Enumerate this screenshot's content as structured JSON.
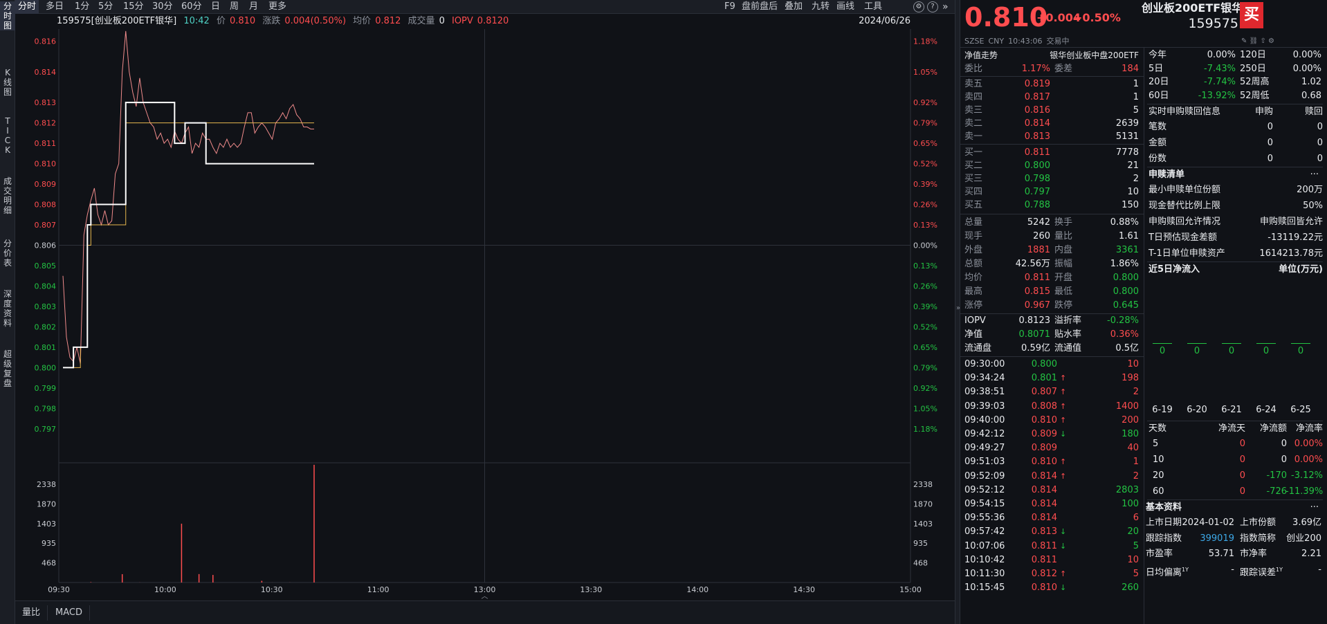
{
  "toolbar": {
    "tabs": [
      "分时",
      "多日",
      "1分",
      "5分",
      "15分",
      "30分",
      "60分",
      "日",
      "周",
      "月",
      "更多"
    ],
    "right": [
      "F9",
      "盘前盘后",
      "叠加",
      "九转",
      "画线",
      "工具"
    ]
  },
  "leftbar": [
    "分时图",
    "K线图",
    "TICK",
    "成交明细",
    "分价表",
    "深度资料",
    "超级复盘"
  ],
  "infobar": {
    "code": "159575[创业板200ETF银华]",
    "time": "10:42",
    "price_label": "价",
    "price": "0.810",
    "chg_label": "涨跌",
    "chg": "0.004(0.50%)",
    "avg_label": "均价",
    "avg": "0.812",
    "vol_label": "成交量",
    "vol": "0",
    "iopv_label": "IOPV",
    "iopv": "0.8120",
    "date": "2024/06/26"
  },
  "chart_data": {
    "type": "line",
    "y_left": [
      "0.816",
      "0.814",
      "0.813",
      "0.812",
      "0.811",
      "0.810",
      "0.809",
      "0.808",
      "0.807",
      "0.806",
      "0.805",
      "0.804",
      "0.803",
      "0.802",
      "0.801",
      "0.800",
      "0.799",
      "0.798",
      "0.797"
    ],
    "y_right": [
      "1.18%",
      "1.05%",
      "0.92%",
      "0.79%",
      "0.65%",
      "0.52%",
      "0.39%",
      "0.26%",
      "0.13%",
      "0.00%",
      "0.13%",
      "0.26%",
      "0.39%",
      "0.52%",
      "0.65%",
      "0.79%",
      "0.92%",
      "1.05%",
      "1.18%"
    ],
    "vol_ticks": [
      "2338",
      "1870",
      "1403",
      "935",
      "468"
    ],
    "x_labels": [
      "09:30",
      "10:00",
      "10:30",
      "11:00",
      "13:00",
      "13:30",
      "14:00",
      "14:30",
      "15:00"
    ],
    "price_series": [
      0.8,
      0.8,
      0.8,
      0.801,
      0.801,
      0.801,
      0.801,
      0.807,
      0.808,
      0.808,
      0.808,
      0.808,
      0.808,
      0.808,
      0.808,
      0.808,
      0.808,
      0.808,
      0.813,
      0.813,
      0.813,
      0.813,
      0.813,
      0.813,
      0.813,
      0.813,
      0.813,
      0.813,
      0.813,
      0.813,
      0.813,
      0.813,
      0.811,
      0.811,
      0.811,
      0.812,
      0.812,
      0.812,
      0.812,
      0.812,
      0.812,
      0.81,
      0.81,
      0.81,
      0.81,
      0.81,
      0.81,
      0.81,
      0.81,
      0.81,
      0.81,
      0.81,
      0.81,
      0.81,
      0.81,
      0.81,
      0.81,
      0.81,
      0.81,
      0.81,
      0.81,
      0.81,
      0.81,
      0.81,
      0.81,
      0.81,
      0.81,
      0.81,
      0.81,
      0.81,
      0.81,
      0.81,
      0.81
    ],
    "avg_series": [
      0.8,
      0.8,
      0.8,
      0.8,
      0.8,
      0.801,
      0.801,
      0.806,
      0.807,
      0.807,
      0.807,
      0.807,
      0.807,
      0.807,
      0.807,
      0.807,
      0.807,
      0.807,
      0.812,
      0.812,
      0.812,
      0.812,
      0.812,
      0.812,
      0.812,
      0.812,
      0.812,
      0.812,
      0.812,
      0.812,
      0.812,
      0.812,
      0.812,
      0.812,
      0.812,
      0.812,
      0.812,
      0.812,
      0.812,
      0.812,
      0.812,
      0.812,
      0.812,
      0.812,
      0.812,
      0.812,
      0.812,
      0.812,
      0.812,
      0.812,
      0.812,
      0.812,
      0.812,
      0.812,
      0.812,
      0.812,
      0.812,
      0.812,
      0.812,
      0.812,
      0.812,
      0.812,
      0.812,
      0.812,
      0.812,
      0.812,
      0.812,
      0.812,
      0.812,
      0.812,
      0.812,
      0.812,
      0.812
    ],
    "iopv_series": [
      0.8045,
      0.8015,
      0.8005,
      0.8003,
      0.801,
      0.8002,
      0.8065,
      0.8075,
      0.8082,
      0.8088,
      0.8075,
      0.807,
      0.8077,
      0.807,
      0.8072,
      0.8095,
      0.81,
      0.8145,
      0.8165,
      0.8145,
      0.8135,
      0.8128,
      0.8142,
      0.813,
      0.8125,
      0.812,
      0.8118,
      0.8112,
      0.8115,
      0.811,
      0.8112,
      0.8108,
      0.8116,
      0.8112,
      0.811,
      0.8115,
      0.8118,
      0.8105,
      0.811,
      0.8108,
      0.8115,
      0.8112,
      0.8112,
      0.8108,
      0.8105,
      0.811,
      0.8108,
      0.8112,
      0.8108,
      0.811,
      0.8108,
      0.811,
      0.8118,
      0.8125,
      0.8125,
      0.8115,
      0.8118,
      0.812,
      0.8118,
      0.8115,
      0.8112,
      0.812,
      0.8122,
      0.8125,
      0.8122,
      0.8127,
      0.8129,
      0.8124,
      0.8122,
      0.8118,
      0.8118,
      0.8117,
      0.8117
    ],
    "volume_series": [
      0,
      0,
      0,
      0,
      0,
      0,
      0,
      0,
      10,
      0,
      0,
      0,
      0,
      0,
      0,
      0,
      0,
      198,
      0,
      0,
      0,
      0,
      2,
      0,
      0,
      0,
      0,
      0,
      0,
      0,
      0,
      0,
      0,
      0,
      1400,
      0,
      0,
      0,
      0,
      200,
      0,
      0,
      0,
      180,
      0,
      0,
      0,
      0,
      0,
      0,
      0,
      0,
      0,
      0,
      0,
      0,
      0,
      40,
      0,
      0,
      1,
      0,
      0,
      0,
      0,
      2,
      0,
      0,
      0,
      0,
      0,
      0,
      2803
    ]
  },
  "bottom_tabs": [
    "量比",
    "MACD"
  ],
  "quote": {
    "price": "0.810",
    "chg": "+0.004",
    "pct": "+0.50%",
    "name": "创业板200ETF银华",
    "code": "159575",
    "buy_btn": "买",
    "meta": [
      "SZSE",
      "CNY",
      "10:43:06",
      "交易中"
    ],
    "nav_label": "净值走势",
    "nav_name": "银华创业板中盘200ETF"
  },
  "returns": [
    {
      "l": "今年",
      "v": "0.00%",
      "l2": "120日",
      "v2": "0.00%",
      "c": "white",
      "c2": "white"
    },
    {
      "l": "5日",
      "v": "-7.43%",
      "l2": "250日",
      "v2": "0.00%",
      "c": "green",
      "c2": "white"
    },
    {
      "l": "20日",
      "v": "-7.74%",
      "l2": "52周高",
      "v2": "1.02",
      "c": "green",
      "c2": "white"
    },
    {
      "l": "60日",
      "v": "-13.92%",
      "l2": "52周低",
      "v2": "0.68",
      "c": "green",
      "c2": "white"
    }
  ],
  "order_book": {
    "webi_label": "委比",
    "webi": "1.17%",
    "weicha_label": "委差",
    "weicha": "184",
    "asks": [
      {
        "l": "卖五",
        "p": "0.819",
        "v": "1"
      },
      {
        "l": "卖四",
        "p": "0.817",
        "v": "1"
      },
      {
        "l": "卖三",
        "p": "0.816",
        "v": "5"
      },
      {
        "l": "卖二",
        "p": "0.814",
        "v": "2639"
      },
      {
        "l": "卖一",
        "p": "0.813",
        "v": "5131"
      }
    ],
    "bids": [
      {
        "l": "买一",
        "p": "0.811",
        "v": "7778"
      },
      {
        "l": "买二",
        "p": "0.800",
        "v": "21"
      },
      {
        "l": "买三",
        "p": "0.798",
        "v": "2"
      },
      {
        "l": "买四",
        "p": "0.797",
        "v": "10"
      },
      {
        "l": "买五",
        "p": "0.788",
        "v": "150"
      }
    ]
  },
  "stats": [
    {
      "l": "总量",
      "v": "5242",
      "vc": "white",
      "l2": "换手",
      "v2": "0.88%",
      "vc2": "white"
    },
    {
      "l": "现手",
      "v": "260",
      "vc": "white",
      "l2": "量比",
      "v2": "1.61",
      "vc2": "white"
    },
    {
      "l": "外盘",
      "v": "1881",
      "vc": "red",
      "l2": "内盘",
      "v2": "3361",
      "vc2": "green"
    },
    {
      "l": "总额",
      "v": "42.56万",
      "vc": "white",
      "l2": "振幅",
      "v2": "1.86%",
      "vc2": "white"
    },
    {
      "l": "均价",
      "v": "0.811",
      "vc": "red",
      "l2": "开盘",
      "v2": "0.800",
      "vc2": "green"
    },
    {
      "l": "最高",
      "v": "0.815",
      "vc": "red",
      "l2": "最低",
      "v2": "0.800",
      "vc2": "green"
    },
    {
      "l": "涨停",
      "v": "0.967",
      "vc": "red",
      "l2": "跌停",
      "v2": "0.645",
      "vc2": "green"
    }
  ],
  "stats2": [
    {
      "l": "IOPV",
      "v": "0.8123",
      "vc": "white",
      "l2": "溢折率",
      "v2": "-0.28%",
      "vc2": "green"
    },
    {
      "l": "净值",
      "v": "0.8071",
      "vc": "green",
      "l2": "贴水率",
      "v2": "0.36%",
      "vc2": "red"
    },
    {
      "l": "流通盘",
      "v": "0.59亿",
      "vc": "white",
      "l2": "流通值",
      "v2": "0.5亿",
      "vc2": "white"
    }
  ],
  "ticks": [
    {
      "t": "09:30:00",
      "p": "0.800",
      "pc": "green",
      "a": "",
      "v": "10",
      "vc": "red"
    },
    {
      "t": "09:34:24",
      "p": "0.801",
      "pc": "green",
      "a": "up",
      "v": "198",
      "vc": "red"
    },
    {
      "t": "09:38:51",
      "p": "0.807",
      "pc": "red",
      "a": "up",
      "v": "2",
      "vc": "red"
    },
    {
      "t": "09:39:03",
      "p": "0.808",
      "pc": "red",
      "a": "up",
      "v": "1400",
      "vc": "red"
    },
    {
      "t": "09:40:00",
      "p": "0.810",
      "pc": "red",
      "a": "up",
      "v": "200",
      "vc": "red"
    },
    {
      "t": "09:42:12",
      "p": "0.809",
      "pc": "red",
      "a": "down",
      "v": "180",
      "vc": "green"
    },
    {
      "t": "09:49:27",
      "p": "0.809",
      "pc": "red",
      "a": "",
      "v": "40",
      "vc": "red"
    },
    {
      "t": "09:51:03",
      "p": "0.810",
      "pc": "red",
      "a": "up",
      "v": "1",
      "vc": "red"
    },
    {
      "t": "09:52:09",
      "p": "0.814",
      "pc": "red",
      "a": "up",
      "v": "2",
      "vc": "red"
    },
    {
      "t": "09:52:12",
      "p": "0.814",
      "pc": "red",
      "a": "",
      "v": "2803",
      "vc": "green"
    },
    {
      "t": "09:54:15",
      "p": "0.814",
      "pc": "red",
      "a": "",
      "v": "100",
      "vc": "green"
    },
    {
      "t": "09:55:36",
      "p": "0.814",
      "pc": "red",
      "a": "",
      "v": "6",
      "vc": "red"
    },
    {
      "t": "09:57:42",
      "p": "0.813",
      "pc": "red",
      "a": "down",
      "v": "20",
      "vc": "green"
    },
    {
      "t": "10:07:06",
      "p": "0.811",
      "pc": "red",
      "a": "down",
      "v": "5",
      "vc": "green"
    },
    {
      "t": "10:10:42",
      "p": "0.811",
      "pc": "red",
      "a": "",
      "v": "10",
      "vc": "red"
    },
    {
      "t": "10:11:30",
      "p": "0.812",
      "pc": "red",
      "a": "up",
      "v": "5",
      "vc": "red"
    },
    {
      "t": "10:15:45",
      "p": "0.810",
      "pc": "red",
      "a": "down",
      "v": "260",
      "vc": "green"
    }
  ],
  "subscription": {
    "header": [
      "实时申购赎回信息",
      "申购",
      "赎回"
    ],
    "rows": [
      [
        "笔数",
        "0",
        "0"
      ],
      [
        "金额",
        "0",
        "0"
      ],
      [
        "份数",
        "0",
        "0"
      ]
    ]
  },
  "creation_list": {
    "title": "申赎清单",
    "more": "···",
    "rows": [
      [
        "最小申赎单位份额",
        "200万"
      ],
      [
        "现金替代比例上限",
        "50%"
      ],
      [
        "申购赎回允许情况",
        "申购赎回皆允许"
      ],
      [
        "T日预估现金差额",
        "-13119.22元"
      ],
      [
        "T-1日单位申赎资产",
        "1614213.78元"
      ]
    ]
  },
  "netflow": {
    "title": "近5日净流入",
    "unit": "单位(万元)",
    "values": [
      "0",
      "0",
      "0",
      "0",
      "0"
    ],
    "dates": [
      "6-19",
      "6-20",
      "6-21",
      "6-24",
      "6-25"
    ],
    "table_header": [
      "天数",
      "净流天",
      "净流额",
      "净流率"
    ],
    "table": [
      [
        "5",
        "0",
        "0",
        "0.00%"
      ],
      [
        "10",
        "0",
        "0",
        "0.00%"
      ],
      [
        "20",
        "0",
        "-170",
        "-3.12%"
      ],
      [
        "60",
        "0",
        "-726",
        "-11.39%"
      ]
    ]
  },
  "basic": {
    "title": "基本资料",
    "more": "···",
    "rows": [
      {
        "l": "上市日期",
        "v": "2024-01-02",
        "l2": "上市份额",
        "v2": "3.69亿",
        "vc": "white"
      },
      {
        "l": "跟踪指数",
        "v": "399019",
        "l2": "指数简称",
        "v2": "创业200",
        "vc": "cyan"
      },
      {
        "l": "市盈率",
        "v": "53.71",
        "l2": "市净率",
        "v2": "2.21",
        "vc": "white"
      },
      {
        "l": "日均偏离",
        "sup": "1Y",
        "v": "-",
        "l2": "跟踪误差",
        "sup2": "1Y",
        "v2": "-",
        "vc": "white"
      }
    ]
  },
  "colors": {
    "up": "#ff4d4f",
    "down": "#23c343",
    "price_line": "#ffffff",
    "avg_line": "#e8b84f",
    "iopv_line": "#f08b8b"
  }
}
